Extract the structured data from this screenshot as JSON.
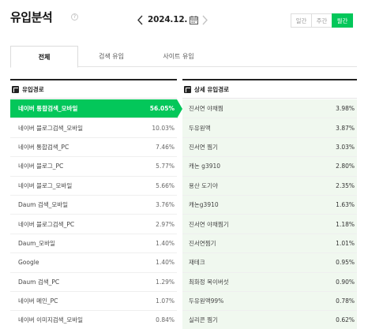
{
  "header": {
    "title": "유입분석",
    "help": "?",
    "date": "2024.12.",
    "period_options": [
      {
        "label": "일간",
        "active": false
      },
      {
        "label": "주간",
        "active": false
      },
      {
        "label": "월간",
        "active": true
      }
    ]
  },
  "tabs": [
    {
      "label": "전체",
      "active": true
    },
    {
      "label": "검색 유입",
      "active": false
    },
    {
      "label": "사이트 유입",
      "active": false
    }
  ],
  "left_panel": {
    "title": "유입경로",
    "rows": [
      {
        "label": "네이버 통합검색_모바일",
        "value": "56.05%",
        "active": true
      },
      {
        "label": "네이버 블로그검색_모바일",
        "value": "10.03%"
      },
      {
        "label": "네이버 통합검색_PC",
        "value": "7.46%"
      },
      {
        "label": "네이버 블로그_PC",
        "value": "5.77%"
      },
      {
        "label": "네이버 블로그_모바일",
        "value": "5.66%"
      },
      {
        "label": "Daum 검색_모바일",
        "value": "3.76%"
      },
      {
        "label": "네이버 블로그검색_PC",
        "value": "2.97%"
      },
      {
        "label": "Daum_모바일",
        "value": "1.40%"
      },
      {
        "label": "Google",
        "value": "1.40%"
      },
      {
        "label": "Daum 검색_PC",
        "value": "1.29%"
      },
      {
        "label": "네이버 메인_PC",
        "value": "1.07%"
      },
      {
        "label": "네이버 이미지검색_모바일",
        "value": "0.84%"
      }
    ]
  },
  "right_panel": {
    "title": "상세 유입경로",
    "rows": [
      {
        "label": "진서연 야채찜",
        "value": "3.98%"
      },
      {
        "label": "두유원액",
        "value": "3.87%"
      },
      {
        "label": "진서연 찜기",
        "value": "3.03%"
      },
      {
        "label": "캐논 g3910",
        "value": "2.80%"
      },
      {
        "label": "용산 도기야",
        "value": "2.35%"
      },
      {
        "label": "캐논g3910",
        "value": "1.63%"
      },
      {
        "label": "진서연 야채찜기",
        "value": "1.18%"
      },
      {
        "label": "진서연찜기",
        "value": "1.01%"
      },
      {
        "label": "재테크",
        "value": "0.95%"
      },
      {
        "label": "최화정 목이버섯",
        "value": "0.90%"
      },
      {
        "label": "두유원액99%",
        "value": "0.78%"
      },
      {
        "label": "실리콘 찜기",
        "value": "0.62%"
      }
    ]
  },
  "colors": {
    "accent": "#03c75a",
    "detail_row_bg": "#f0f8ef"
  }
}
